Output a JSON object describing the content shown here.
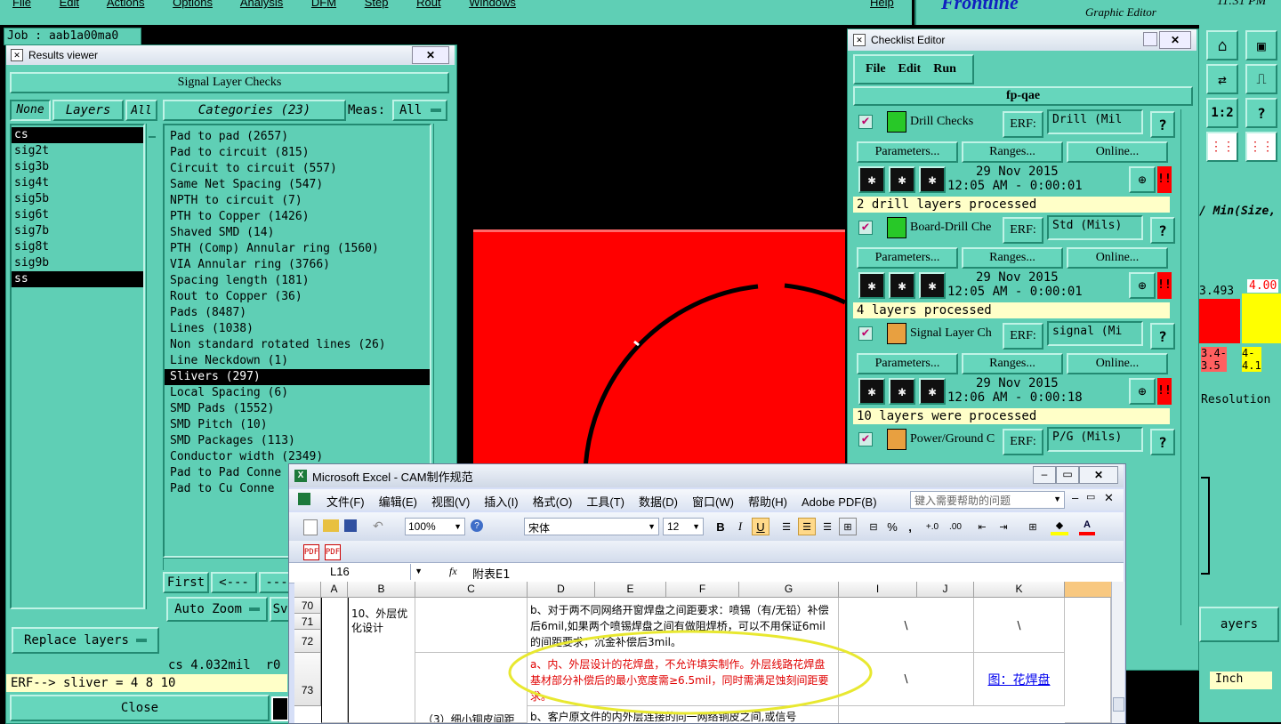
{
  "topmenu": {
    "items": [
      "File",
      "Edit",
      "Actions",
      "Options",
      "Analysis",
      "DFM",
      "Step",
      "Rout",
      "Windows"
    ],
    "help": "Help",
    "brand": "Frontline",
    "subbrand": "Graphic Editor",
    "clock": "11:31 PM"
  },
  "job": {
    "label": "Job : aab1a00ma0"
  },
  "results_viewer": {
    "title": "Results viewer",
    "header": "Signal Layer Checks",
    "none_btn": "None",
    "layers_btn": "Layers",
    "all_btn": "All",
    "categories_btn": "Categories (23)",
    "meas_label": "Meas:",
    "meas_value": "All",
    "layers": [
      "cs",
      "sig2t",
      "sig3b",
      "sig4t",
      "sig5b",
      "sig6t",
      "sig7b",
      "sig8t",
      "sig9b",
      "ss"
    ],
    "categories": [
      "Pad to pad (2657)",
      "Pad to circuit (815)",
      "Circuit to circuit (557)",
      "Same Net Spacing (547)",
      "NPTH to circuit (7)",
      "PTH to Copper (1426)",
      "Shaved SMD (14)",
      "PTH (Comp) Annular ring (1560)",
      "VIA Annular ring (3766)",
      "Spacing length (181)",
      "Rout to Copper (36)",
      "Pads (8487)",
      "Lines (1038)",
      "Non standard rotated lines (26)",
      "Line Neckdown (1)",
      "Slivers (297)",
      "Local Spacing (6)",
      "SMD Pads (1552)",
      "SMD Pitch (10)",
      "SMD Packages (113)",
      "Conductor width (2349)",
      "Pad to Pad Conne",
      "Pad to Cu Conne"
    ],
    "first_btn": "First",
    "prev_btn": "<---",
    "next_btn": "---",
    "autozoom": "Auto Zoom",
    "sv": "Sv",
    "replace_layers": "Replace layers",
    "status_line": "cs 4.032mil  r0",
    "erf_line": "ERF--> sliver = 4 8 10",
    "close_btn": "Close"
  },
  "checklist_editor": {
    "title": "Checklist Editor",
    "menu": [
      "File",
      "Edit",
      "Run"
    ],
    "checklist_name": "fp-qae",
    "erf_label": "ERF:",
    "params_btn": "Parameters...",
    "ranges_btn": "Ranges...",
    "online_btn": "Online...",
    "help_btn": "?",
    "checks": [
      {
        "name": "Drill Checks",
        "erf": "Drill (Mil",
        "date": "29 Nov 2015",
        "time": "12:05 AM - 0:00:01",
        "status": "2 drill layers processed"
      },
      {
        "name": "Board-Drill Che",
        "erf": "Std (Mils)",
        "date": "29 Nov 2015",
        "time": "12:05 AM - 0:00:01",
        "status": "4 layers processed"
      },
      {
        "name": "Signal Layer Ch",
        "erf": "signal (Mi",
        "date": "29 Nov 2015",
        "time": "12:06 AM - 0:00:18",
        "status": "10 layers were processed"
      },
      {
        "name": "Power/Ground C",
        "erf": "P/G (Mils)"
      }
    ],
    "partial_online": "e...",
    "partial_d": "d"
  },
  "right_panel": {
    "min_size": "/ Min(Size,",
    "val1": "3.493",
    "val2": "4.00",
    "range1": "3.4-\n3.5",
    "range2": "4-\n4.1",
    "resolution": "Resolution",
    "layers": "ayers",
    "inch": "Inch"
  },
  "excel": {
    "title": "Microsoft Excel - CAM制作规范",
    "menu": [
      "文件(F)",
      "编辑(E)",
      "视图(V)",
      "插入(I)",
      "格式(O)",
      "工具(T)",
      "数据(D)",
      "窗口(W)",
      "帮助(H)",
      "Adobe PDF(B)"
    ],
    "help_placeholder": "键入需要帮助的问题",
    "zoom": "100%",
    "font": "宋体",
    "font_size": "12",
    "bold": "B",
    "italic": "I",
    "underline": "U",
    "percent": "%",
    "comma": ",",
    "cell_ref": "L16",
    "fx": "fx",
    "formula": "附表E1",
    "columns": [
      "A",
      "B",
      "C",
      "D",
      "E",
      "F",
      "G",
      "I",
      "J",
      "K"
    ],
    "rows": [
      "70",
      "71",
      "72",
      "73"
    ],
    "b_cell": "10、外层优化设计",
    "c_cell": "（3）细小铜皮间距",
    "d_text1": "b、对于两不同网络开窗焊盘之间距要求：喷锡（有/无铅）补偿后6mil,如果两个喷锡焊盘之间有做阻焊桥，可以不用保证6mil的间距要求；沉金补偿后3mil。",
    "d_text2": "a、内、外层设计的花焊盘，不允许填实制作。外层线路花焊盘基材部分补偿后的最小宽度需≥6.5mil，同时需满足蚀刻间距要求。",
    "d_text3": "b、客户原文件的内外层连接的同一网络铜皮之间,或信号",
    "i_cell": "\\",
    "k_cell": "\\",
    "link": "图：花焊盘"
  },
  "colors": {
    "teal": "#5fcfb5",
    "red": "#ff0000",
    "yellow": "#ffff00",
    "black": "#000000"
  }
}
